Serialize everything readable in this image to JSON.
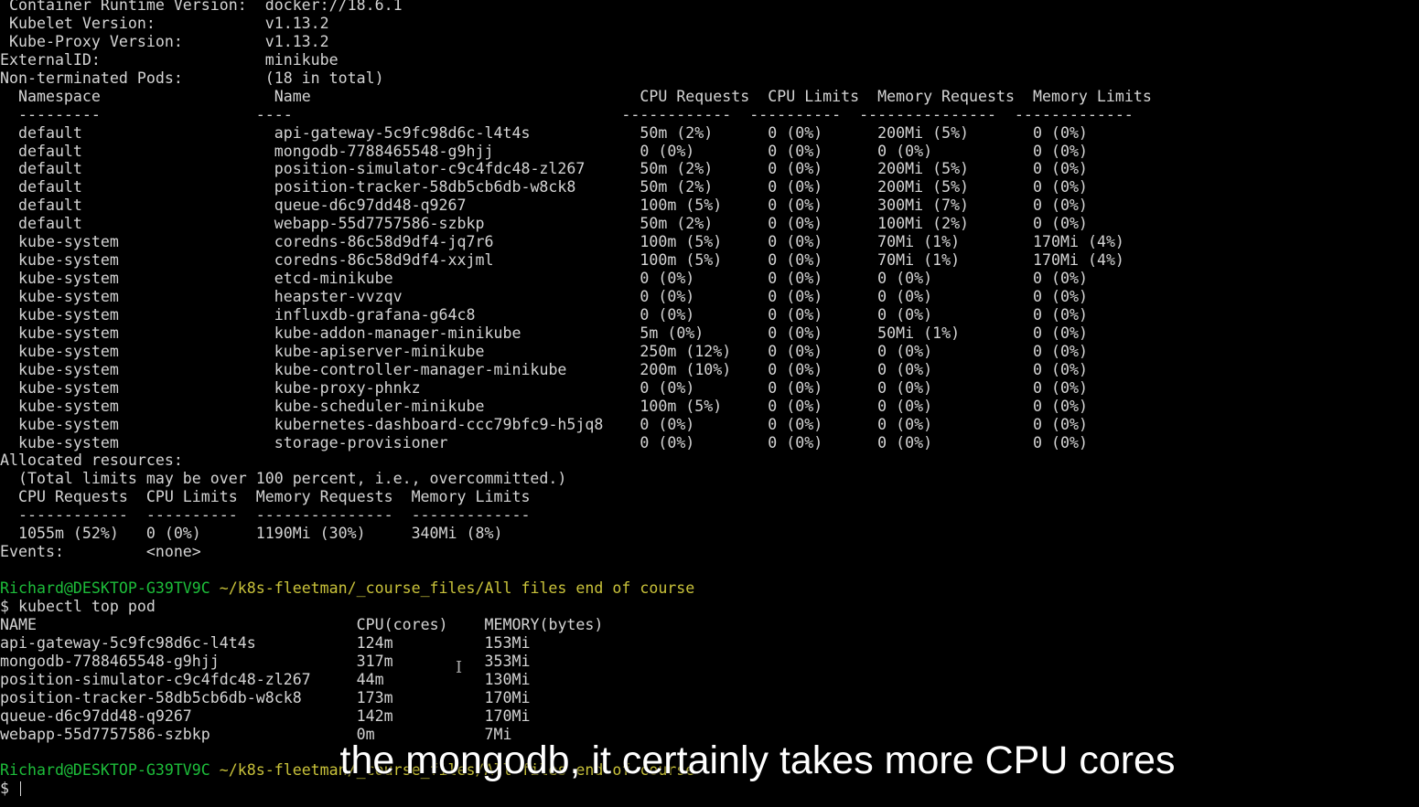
{
  "node_describe": {
    "header_lines": [
      " Container Runtime Version:  docker://18.6.1",
      " Kubelet Version:            v1.13.2",
      " Kube-Proxy Version:         v1.13.2",
      "ExternalID:                  minikube",
      "Non-terminated Pods:         (18 in total)"
    ],
    "pod_columns": [
      "Namespace",
      "Name",
      "CPU Requests",
      "CPU Limits",
      "Memory Requests",
      "Memory Limits"
    ],
    "pod_underline": "  ---------                 ----                                    ------------  ----------  ---------------  -------------",
    "pods": [
      [
        "default",
        "api-gateway-5c9fc98d6c-l4t4s",
        "50m (2%)",
        "0 (0%)",
        "200Mi (5%)",
        "0 (0%)"
      ],
      [
        "default",
        "mongodb-7788465548-g9hjj",
        "0 (0%)",
        "0 (0%)",
        "0 (0%)",
        "0 (0%)"
      ],
      [
        "default",
        "position-simulator-c9c4fdc48-zl267",
        "50m (2%)",
        "0 (0%)",
        "200Mi (5%)",
        "0 (0%)"
      ],
      [
        "default",
        "position-tracker-58db5cb6db-w8ck8",
        "50m (2%)",
        "0 (0%)",
        "200Mi (5%)",
        "0 (0%)"
      ],
      [
        "default",
        "queue-d6c97dd48-q9267",
        "100m (5%)",
        "0 (0%)",
        "300Mi (7%)",
        "0 (0%)"
      ],
      [
        "default",
        "webapp-55d7757586-szbkp",
        "50m (2%)",
        "0 (0%)",
        "100Mi (2%)",
        "0 (0%)"
      ],
      [
        "kube-system",
        "coredns-86c58d9df4-jq7r6",
        "100m (5%)",
        "0 (0%)",
        "70Mi (1%)",
        "170Mi (4%)"
      ],
      [
        "kube-system",
        "coredns-86c58d9df4-xxjml",
        "100m (5%)",
        "0 (0%)",
        "70Mi (1%)",
        "170Mi (4%)"
      ],
      [
        "kube-system",
        "etcd-minikube",
        "0 (0%)",
        "0 (0%)",
        "0 (0%)",
        "0 (0%)"
      ],
      [
        "kube-system",
        "heapster-vvzqv",
        "0 (0%)",
        "0 (0%)",
        "0 (0%)",
        "0 (0%)"
      ],
      [
        "kube-system",
        "influxdb-grafana-g64c8",
        "0 (0%)",
        "0 (0%)",
        "0 (0%)",
        "0 (0%)"
      ],
      [
        "kube-system",
        "kube-addon-manager-minikube",
        "5m (0%)",
        "0 (0%)",
        "50Mi (1%)",
        "0 (0%)"
      ],
      [
        "kube-system",
        "kube-apiserver-minikube",
        "250m (12%)",
        "0 (0%)",
        "0 (0%)",
        "0 (0%)"
      ],
      [
        "kube-system",
        "kube-controller-manager-minikube",
        "200m (10%)",
        "0 (0%)",
        "0 (0%)",
        "0 (0%)"
      ],
      [
        "kube-system",
        "kube-proxy-phnkz",
        "0 (0%)",
        "0 (0%)",
        "0 (0%)",
        "0 (0%)"
      ],
      [
        "kube-system",
        "kube-scheduler-minikube",
        "100m (5%)",
        "0 (0%)",
        "0 (0%)",
        "0 (0%)"
      ],
      [
        "kube-system",
        "kubernetes-dashboard-ccc79bfc9-h5jq8",
        "0 (0%)",
        "0 (0%)",
        "0 (0%)",
        "0 (0%)"
      ],
      [
        "kube-system",
        "storage-provisioner",
        "0 (0%)",
        "0 (0%)",
        "0 (0%)",
        "0 (0%)"
      ]
    ],
    "allocated_lines": [
      "Allocated resources:",
      "  (Total limits may be over 100 percent, i.e., overcommitted.)",
      "  CPU Requests  CPU Limits  Memory Requests  Memory Limits",
      "  ------------  ----------  ---------------  -------------",
      "  1055m (52%)   0 (0%)      1190Mi (30%)     340Mi (8%)",
      "Events:         <none>"
    ]
  },
  "prompt": {
    "user_host": "Richard@DESKTOP-G39TV9C",
    "path": "~/k8s-fleetman/_course_files/All files end of course",
    "command": "$ kubectl top pod"
  },
  "top_pod": {
    "columns": [
      "NAME",
      "CPU(cores)",
      "MEMORY(bytes)"
    ],
    "rows": [
      [
        "api-gateway-5c9fc98d6c-l4t4s",
        "124m",
        "153Mi"
      ],
      [
        "mongodb-7788465548-g9hjj",
        "317m",
        "353Mi"
      ],
      [
        "position-simulator-c9c4fdc48-zl267",
        "44m",
        "130Mi"
      ],
      [
        "position-tracker-58db5cb6db-w8ck8",
        "173m",
        "170Mi"
      ],
      [
        "queue-d6c97dd48-q9267",
        "142m",
        "170Mi"
      ],
      [
        "webapp-55d7757586-szbkp",
        "0m",
        "7Mi"
      ]
    ]
  },
  "final_prompt": {
    "user_host": "Richard@DESKTOP-G39TV9C",
    "path": "~/k8s-fleetman/_course_files/All files end of course",
    "dollar": "$ "
  },
  "subtitle": "the mongodb, it certainly takes more CPU cores",
  "colors": {
    "background": "#000000",
    "text": "#d4d4d4",
    "prompt_user": "#1dbd3a",
    "prompt_path": "#c9c23a"
  }
}
